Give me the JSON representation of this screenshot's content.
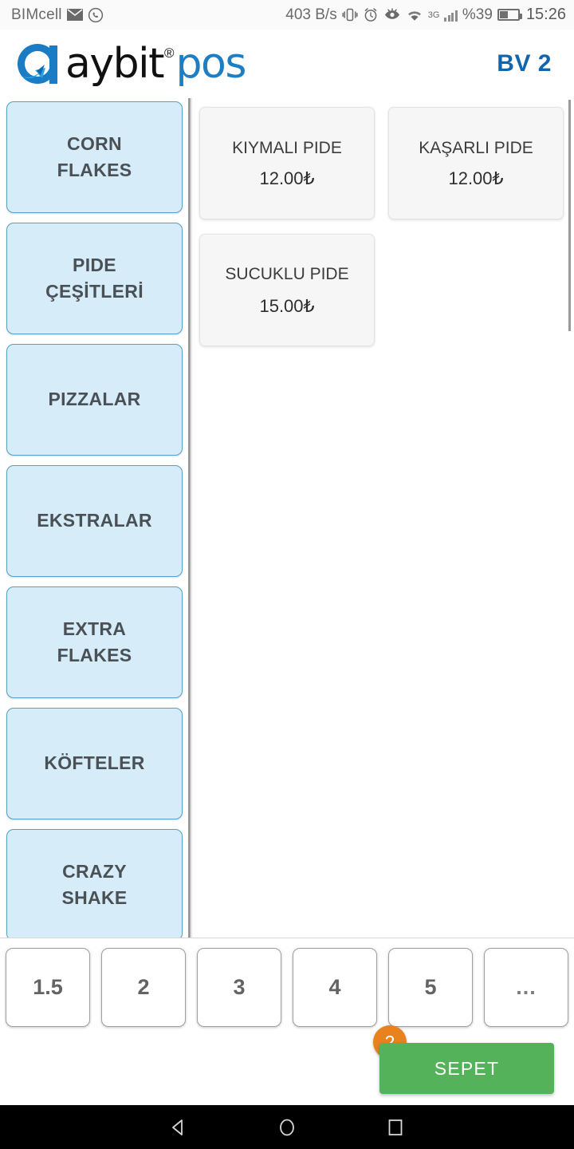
{
  "status_bar": {
    "carrier": "BIMcell",
    "mail_icon": "mail-icon",
    "whatsapp_icon": "whatsapp-icon",
    "network_speed": "403 B/s",
    "vibrate_icon": "vibrate-icon",
    "alarm_icon": "alarm-clock-icon",
    "eye_icon": "eye-comfort-icon",
    "wifi_icon": "wifi-icon",
    "network_type": "3G",
    "signal_icon": "signal-bars-icon",
    "battery_percent": "%39",
    "battery_icon": "battery-icon",
    "clock": "15:26"
  },
  "header": {
    "logo_mark": "aybit-logo-icon",
    "brand_primary": "aybit",
    "brand_registered": "®",
    "brand_secondary": "pos",
    "table_label": "BV 2",
    "accent_blue": "#1d7ec4",
    "table_color": "#1464ad"
  },
  "categories": {
    "items": [
      {
        "label": "CORN\nFLAKES"
      },
      {
        "label": "PIDE\nÇEŞİTLERİ"
      },
      {
        "label": "PIZZALAR"
      },
      {
        "label": "EKSTRALAR"
      },
      {
        "label": "EXTRA\nFLAKES"
      },
      {
        "label": "KÖFTELER"
      },
      {
        "label": "CRAZY\nSHAKE"
      }
    ],
    "fill_color": "#d6ecf8",
    "border_color": "#56a0c3",
    "text_color": "#4a5156"
  },
  "products": {
    "items": [
      {
        "name": "KIYMALI PIDE",
        "price": "12.00₺",
        "spaced": false
      },
      {
        "name": "KAŞARLI PIDE",
        "price": "12.00₺",
        "spaced": false
      },
      {
        "name": "SUCUKLU PIDE",
        "price": "15.00₺",
        "spaced": true
      }
    ]
  },
  "bottom_bar": {
    "quantities": [
      "1.5",
      "2",
      "3",
      "4",
      "5",
      "..."
    ],
    "cart_label": "SEPET",
    "cart_count": "2",
    "cart_color": "#54b35a",
    "badge_color": "#e8821e"
  },
  "nav_bar": {
    "back_icon": "back-triangle-icon",
    "home_icon": "home-circle-icon",
    "recents_icon": "recents-square-icon"
  }
}
